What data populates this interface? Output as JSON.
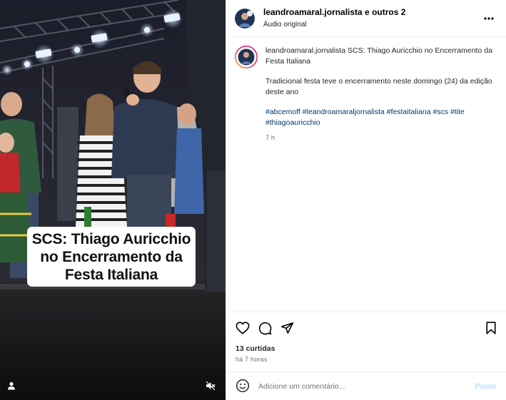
{
  "header": {
    "username": "leandroamaral.jornalista e outros 2",
    "audio": "Áudio original",
    "more_icon": "more-horizontal-icon"
  },
  "media": {
    "caption_overlay": "SCS: Thiago Auricchio\nno Encerramento da\nFesta Italiana",
    "user_icon": "person-icon",
    "mute_icon": "muted-speaker-icon"
  },
  "caption": {
    "username": "leandroamaral.jornalista",
    "title": "SCS: Thiago Auricchio no Encerramento da Festa Italiana",
    "body": "Tradicional festa teve o encerramento neste domingo (24) da edição deste ano",
    "hashtags": [
      "#abcemoff",
      "#leandroamaraljornalista",
      "#festaitaliana",
      "#scs",
      "#tite",
      "#thiagoauricchio"
    ],
    "time": "7 h"
  },
  "actions": {
    "icons": [
      "heart-icon",
      "comment-icon",
      "share-icon",
      "bookmark-icon"
    ],
    "likes": "13 curtidas",
    "ago": "há 7 horas"
  },
  "comment_box": {
    "placeholder": "Adicione um comentário...",
    "post_label": "Postar",
    "post_color": "#a5d0f7"
  },
  "colors": {
    "link": "#00376b",
    "border": "#efefef",
    "muted": "#737373"
  }
}
